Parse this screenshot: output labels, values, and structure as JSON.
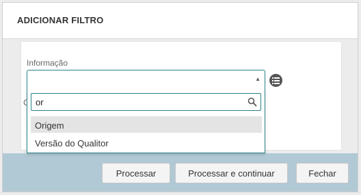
{
  "dialog": {
    "title": "ADICIONAR FILTRO"
  },
  "form": {
    "field_label": "Informação",
    "second_label_fragment": "C",
    "select_value": ""
  },
  "dropdown": {
    "search_value": "or",
    "options": [
      {
        "label": "Origem",
        "highlighted": true
      },
      {
        "label": "Versão do Qualitor",
        "highlighted": false
      }
    ]
  },
  "footer": {
    "processar_label": "Processar",
    "processar_continuar_label": "Processar e continuar",
    "fechar_label": "Fechar"
  },
  "icons": {
    "select_arrow": "triangle-up",
    "list": "list-icon",
    "search": "search-icon"
  },
  "colors": {
    "accent": "#2a7f86",
    "footer_bg": "#b1c9d5",
    "highlight": "#e4e4e4"
  }
}
